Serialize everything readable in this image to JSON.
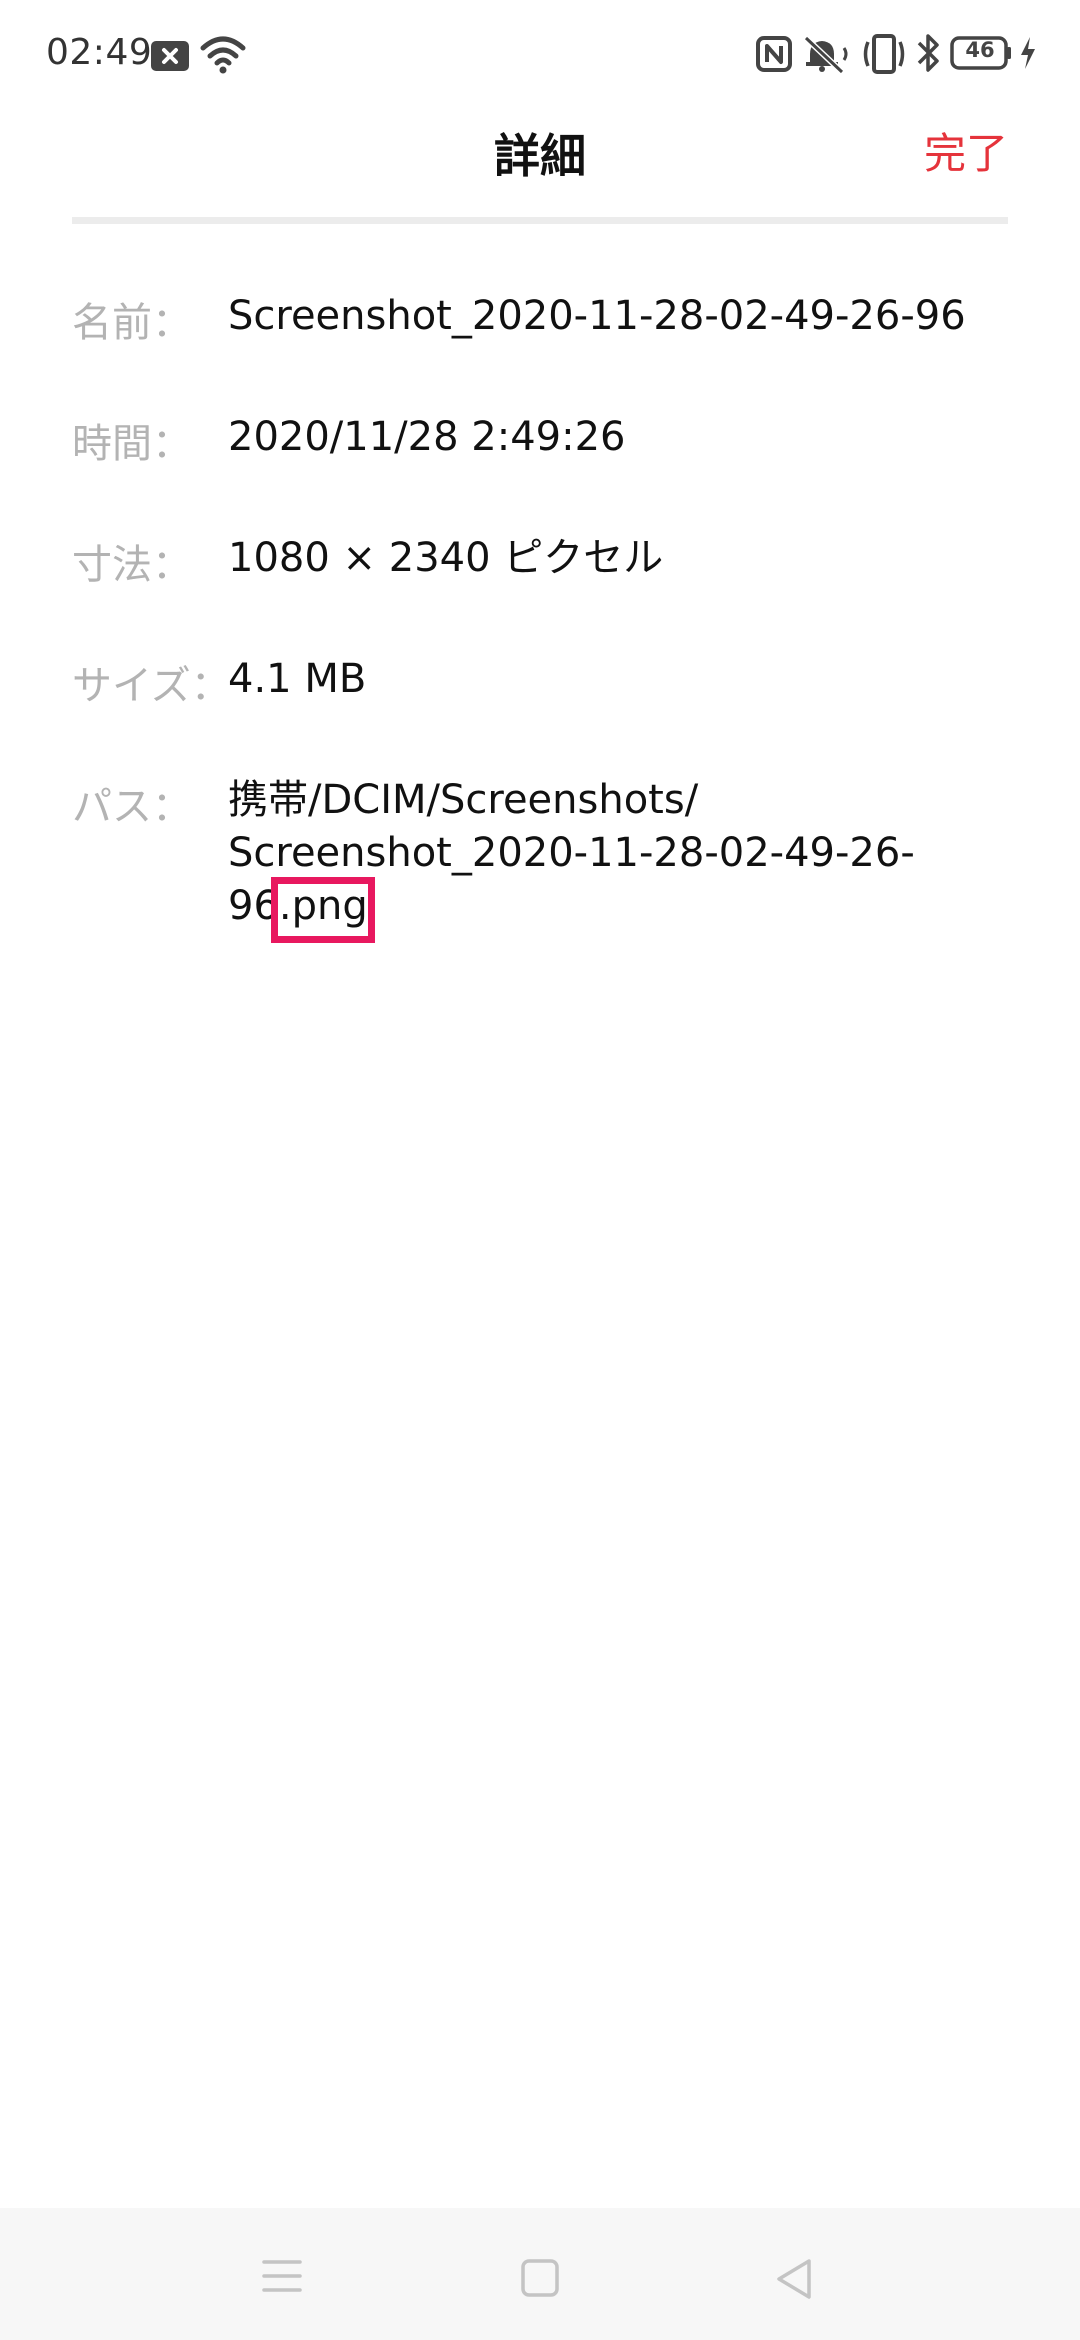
{
  "status_bar": {
    "time": "02:49",
    "battery_level": "46",
    "icons": [
      "notification-x-icon",
      "wifi-icon",
      "nfc-icon",
      "mute-icon",
      "vibrate-icon",
      "bluetooth-icon",
      "battery-icon",
      "charging-icon"
    ]
  },
  "header": {
    "title": "詳細",
    "done_label": "完了"
  },
  "details": {
    "name": {
      "label": "名前：",
      "value": "Screenshot_2020-11-28-02-49-26-96"
    },
    "time": {
      "label": "時間：",
      "value": "2020/11/28 2:49:26"
    },
    "dimensions": {
      "label": "寸法：",
      "value": "1080 × 2340 ピクセル"
    },
    "size": {
      "label": "サイズ：",
      "value": "4.1 MB"
    },
    "path": {
      "label": "パス：",
      "line1": "携帯/DCIM/Screenshots/",
      "line2": "Screenshot_2020-11-28-02-49-26-",
      "line3_prefix": "96",
      "line3_ext": ".png"
    }
  },
  "nav_bar": {
    "icons": [
      "menu-icon",
      "home-icon",
      "back-icon"
    ]
  },
  "colors": {
    "accent": "#e5333b",
    "highlight": "#e8185f",
    "label": "#b3b3b3",
    "text": "#111111"
  }
}
